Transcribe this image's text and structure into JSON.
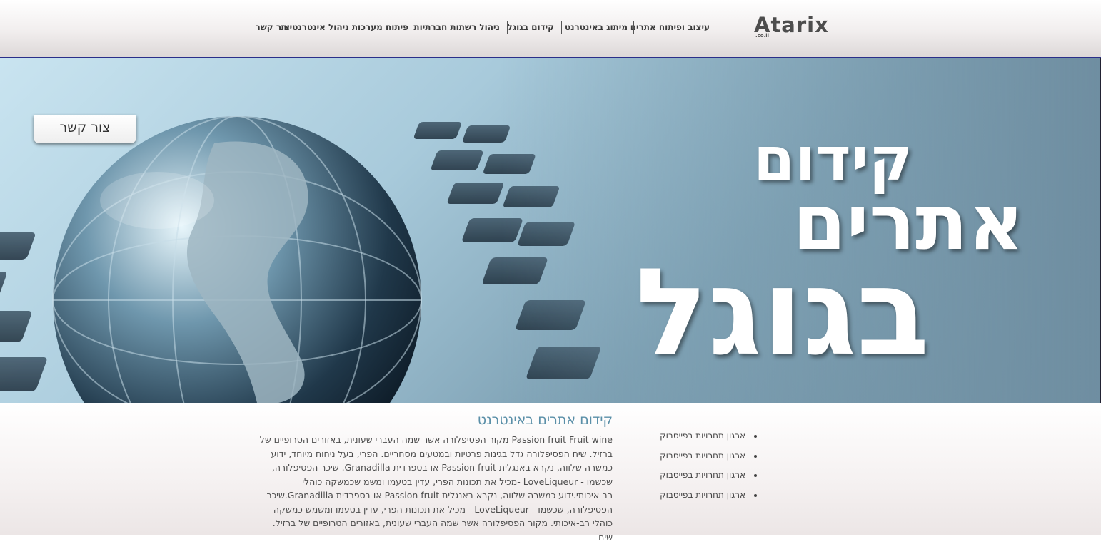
{
  "header": {
    "logo": {
      "text": "Atarix",
      "sub": ".co.il"
    },
    "nav": [
      {
        "label": "עיצוב ופיתוח אתרים"
      },
      {
        "label": "מיתוג באינטרנט"
      },
      {
        "label": "קידום בגוגל"
      },
      {
        "label": "ניהול רשתות חברתיות"
      },
      {
        "label": "פיתוח מערכות ניהול אינטרנטיות"
      },
      {
        "label": "צור קשר"
      }
    ]
  },
  "banner": {
    "contact_tab": "צור קשר",
    "line1": "קידום",
    "line2": "אתרים",
    "line3": "בגוגל"
  },
  "article": {
    "title": "קידום אתרים באינטרנט",
    "body": "Passion fruit Fruit wine מקור הפסיפלורה אשר שמה העברי שעונית, באזורים הטרופיים של ברזיל. שיח הפסיפלורה גדל בגינות פרטיות ובמטעים מסחריים. הפרי, בעל ניחוח מיוחד, ידוע כמשרה שלווה, נקרא באנגלית Passion fruit או בספרדית Granadilla. שיכר הפסיפלורה, שכשמו - LoveLiqueur -מכיל את תכונות הפרי, עדין בטעמו ומשמ שכמשקה כוהלי רב-איכותי.ידוע כמשרה שלווה, נקרא באנגלית Passion fruit או בספרדית Granadilla.שיכר הפסיפלורה, שכשמו - LoveLiqueur - מכיל את תכונות הפרי, עדין בטעמו ומשמש כמשקה כוהלי רב-איכותי. מקור הפסיפלורה אשר שמה העברי שעונית, באזורים הטרופיים של ברזיל. שיח"
  },
  "sidebar": {
    "items": [
      {
        "label": "ארגון תחרויות בפייסבוק"
      },
      {
        "label": "ארגון תחרויות בפייסבוק"
      },
      {
        "label": "ארגון תחרויות בפייסבוק"
      },
      {
        "label": "ארגון תחרויות בפייסבוק"
      }
    ]
  },
  "colors": {
    "accent": "#5a8fa8",
    "nav_text": "#3b3b3b",
    "banner_text": "#ffffff"
  }
}
